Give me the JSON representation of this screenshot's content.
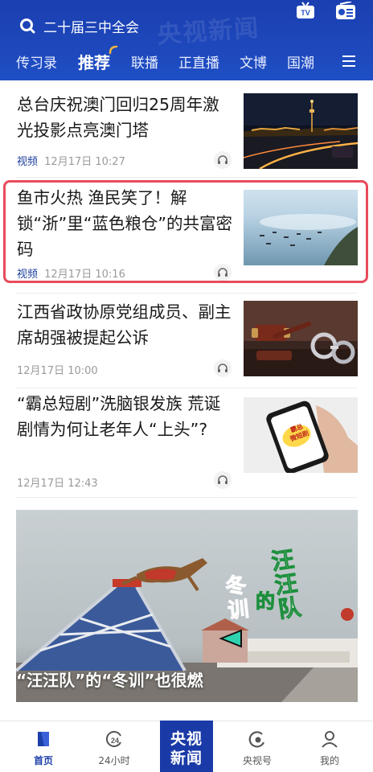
{
  "header": {
    "watermark": "央视新闻",
    "search_text": "二十届三中全会",
    "brand_color": "#1f4ec4"
  },
  "nav": {
    "tabs": [
      {
        "label": "传习录"
      },
      {
        "label": "推荐",
        "active": true
      },
      {
        "label": "联播"
      },
      {
        "label": "正直播"
      },
      {
        "label": "文博"
      },
      {
        "label": "国潮"
      }
    ]
  },
  "news": [
    {
      "title": "总台庆祝澳门回归25周年激光投影点亮澳门塔",
      "tag": "视频",
      "time": "12月17日 10:27",
      "thumb_icon": "macau-night-image"
    },
    {
      "title": "鱼市火热 渔民笑了！解锁“浙”里“蓝色粮仓”的共富密码",
      "tag": "视频",
      "time": "12月17日 10:16",
      "thumb_icon": "sea-boats-image"
    },
    {
      "title": "江西省政协原党组成员、副主席胡强被提起公诉",
      "tag": "",
      "time": "12月17日 10:00",
      "thumb_icon": "gavel-handcuffs-image"
    },
    {
      "title": "“霸总短剧”洗脑银发族 荒诞剧情为何让老年人“上头”?",
      "tag": "",
      "time": "12月17日 12:43",
      "thumb_icon": "phone-short-drama-image"
    }
  ],
  "video_card": {
    "caption": "“汪汪队”的“冬训”也很燃",
    "overlay_text_1": "汪汪队",
    "overlay_text_2": "的",
    "overlay_text_3": "冬训"
  },
  "tabbar": {
    "tabs": [
      {
        "label": "首页",
        "icon": "home-icon",
        "active": true
      },
      {
        "label": "24小时",
        "icon": "clock-24-icon"
      },
      {
        "label": "央视号",
        "icon": "cctv-hao-icon"
      },
      {
        "label": "我的",
        "icon": "profile-icon"
      }
    ],
    "center_line1": "央视",
    "center_line2": "新闻",
    "active_color": "#1c3fa8"
  },
  "phone_thumb_text": "霸总\n微短剧"
}
